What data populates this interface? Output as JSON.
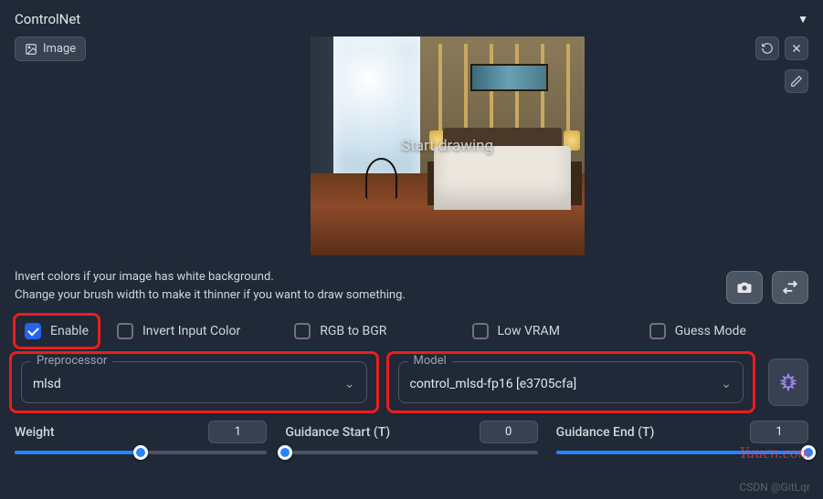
{
  "header": {
    "title": "ControlNet"
  },
  "image_tab": {
    "label": "Image"
  },
  "preview_overlay": "Start drawing",
  "hints": {
    "line1": "Invert colors if your image has white background.",
    "line2": "Change your brush width to make it thinner if you want to draw something."
  },
  "checkboxes": {
    "enable": {
      "label": "Enable",
      "checked": true
    },
    "invert": {
      "label": "Invert Input Color",
      "checked": false
    },
    "rgb2bgr": {
      "label": "RGB to BGR",
      "checked": false
    },
    "lowvram": {
      "label": "Low VRAM",
      "checked": false
    },
    "guess": {
      "label": "Guess Mode",
      "checked": false
    }
  },
  "selects": {
    "preprocessor": {
      "label": "Preprocessor",
      "value": "mlsd"
    },
    "model": {
      "label": "Model",
      "value": "control_mlsd-fp16 [e3705cfa]"
    }
  },
  "run_button": "💥",
  "sliders": {
    "weight": {
      "label": "Weight",
      "value": "1",
      "percent": 50
    },
    "g_start": {
      "label": "Guidance Start (T)",
      "value": "0",
      "percent": 0
    },
    "g_end": {
      "label": "Guidance End (T)",
      "value": "1",
      "percent": 100
    }
  },
  "watermark1": "Yuucn.com",
  "watermark2": "CSDN @GitLqr"
}
